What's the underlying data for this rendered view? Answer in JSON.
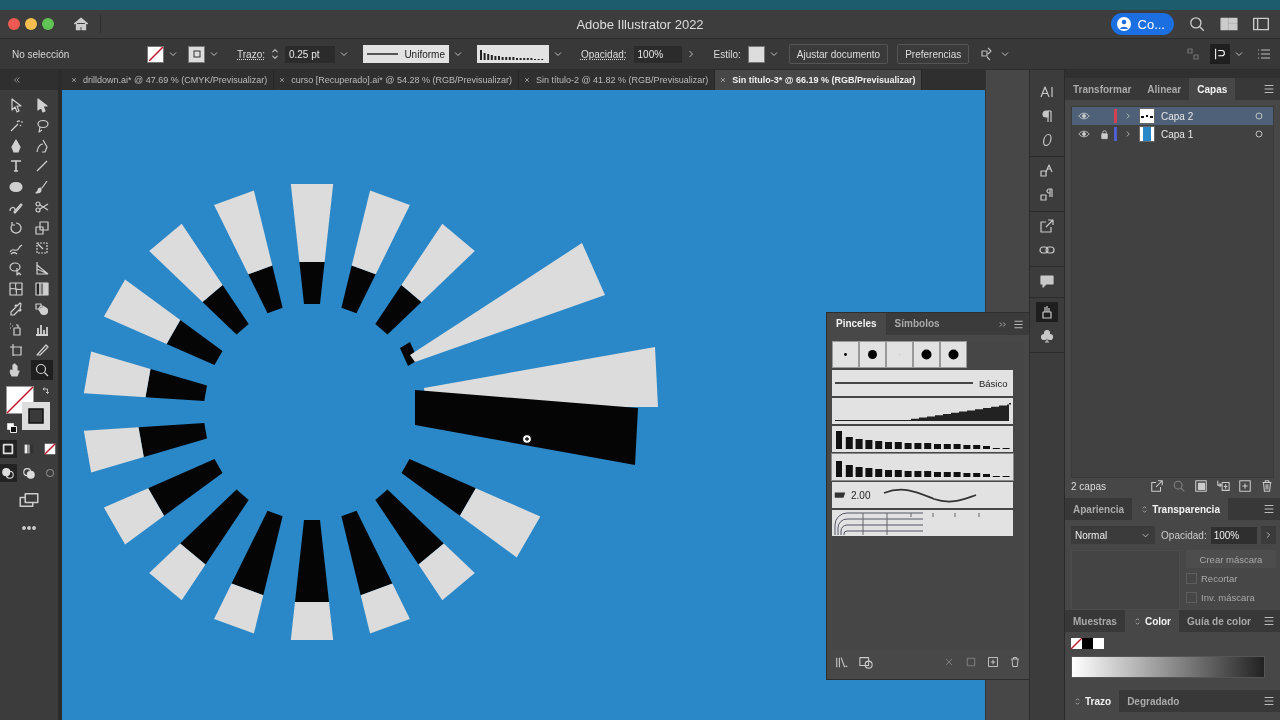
{
  "window": {
    "title": "Adobe Illustrator 2022",
    "share_button": "Co..."
  },
  "control_bar": {
    "selection": "No selección",
    "stroke_label": "Trazo:",
    "stroke_weight": "0.25 pt",
    "stroke_profile": "Uniforme",
    "opacity_label": "Opacidad:",
    "opacity": "100%",
    "style_label": "Estilo:",
    "buttons": [
      "Ajustar documento",
      "Preferencias"
    ]
  },
  "document_tabs": [
    {
      "title": "drilldown.ai* @ 47.69 % (CMYK/Previsualizar)",
      "selected": false
    },
    {
      "title": "curso [Recuperado].ai* @ 54.28 % (RGB/Previsualizar)",
      "selected": false
    },
    {
      "title": "Sin título-2 @ 41.82 % (RGB/Previsualizar)",
      "selected": false
    },
    {
      "title": "Sin título-3* @ 66.19 % (RGB/Previsualizar)",
      "selected": true
    }
  ],
  "tools": [
    {
      "selected": false
    },
    {
      "selected": false
    },
    {
      "selected": false
    },
    {
      "selected": false
    },
    {
      "selected": false
    },
    {
      "selected": false
    },
    {
      "selected": false
    },
    {
      "selected": false
    },
    {
      "selected": false
    },
    {
      "selected": false
    },
    {
      "selected": false
    },
    {
      "selected": false
    },
    {
      "selected": false
    },
    {
      "selected": false
    },
    {
      "selected": false
    },
    {
      "selected": false
    },
    {
      "selected": false
    },
    {
      "selected": false
    },
    {
      "selected": false
    },
    {
      "selected": false
    },
    {
      "selected": false
    },
    {
      "selected": false
    },
    {
      "selected": false
    },
    {
      "selected": false
    },
    {
      "selected": false
    },
    {
      "selected": false
    },
    {
      "selected": false
    },
    {
      "selected": true
    }
  ],
  "panel_icons": [
    {
      "selected": false
    },
    {
      "selected": false
    },
    {
      "selected": false
    },
    {
      "selected": false
    },
    {
      "selected": false
    },
    {
      "selected": false
    },
    {
      "selected": false
    },
    {
      "selected": false
    },
    {
      "selected": true
    },
    {
      "selected": false
    }
  ],
  "brushes_panel": {
    "tabs": [
      {
        "label": "Pinceles",
        "selected": true
      },
      {
        "label": "Símbolos",
        "selected": false
      }
    ],
    "basic_label": "Básico",
    "calligraphic_size": "2.00"
  },
  "layers_panel": {
    "tabs": [
      {
        "label": "Transformar",
        "selected": false
      },
      {
        "label": "Alinear",
        "selected": false
      },
      {
        "label": "Capas",
        "selected": true
      }
    ],
    "layers": [
      {
        "name": "Capa 2",
        "visible": true,
        "locked": false,
        "color": "#d0404f",
        "selected": true
      },
      {
        "name": "Capa 1",
        "visible": true,
        "locked": true,
        "color": "#4f5fd0",
        "selected": false
      }
    ],
    "count": "2 capas"
  },
  "transparency_panel": {
    "tabs": [
      {
        "label": "Apariencia",
        "selected": false,
        "collapsible": false
      },
      {
        "label": "Transparencia",
        "selected": true,
        "collapsible": true
      }
    ],
    "blend_mode": "Normal",
    "opacity_label": "Opacidad:",
    "opacity": "100%",
    "mask_button": {
      "label": "Crear máscara",
      "disabled": true
    },
    "options": [
      {
        "label": "Recortar",
        "checked": false,
        "disabled": true
      },
      {
        "label": "Inv. máscara",
        "checked": false,
        "disabled": true
      }
    ]
  },
  "color_panel": {
    "tabs": [
      {
        "label": "Muestras",
        "selected": false,
        "collapsible": false
      },
      {
        "label": "Color",
        "selected": true,
        "collapsible": true
      },
      {
        "label": "Guía de color",
        "selected": false,
        "collapsible": false
      }
    ]
  },
  "stroke_panel": {
    "tabs": [
      {
        "label": "Trazo",
        "selected": true,
        "collapsible": true
      },
      {
        "label": "Degradado",
        "selected": false,
        "collapsible": false
      }
    ]
  }
}
